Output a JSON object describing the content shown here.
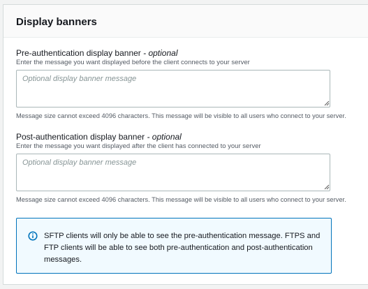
{
  "section": {
    "title": "Display banners"
  },
  "pre_auth": {
    "label": "Pre-authentication display banner",
    "optional": "- optional",
    "description": "Enter the message you want displayed before the client connects to your server",
    "placeholder": "Optional display banner message",
    "value": "",
    "hint": "Message size cannot exceed 4096 characters. This message will be visible to all users who connect to your server."
  },
  "post_auth": {
    "label": "Post-authentication display banner",
    "optional": "- optional",
    "description": "Enter the message you want displayed after the client has connected to your server",
    "placeholder": "Optional display banner message",
    "value": "",
    "hint": "Message size cannot exceed 4096 characters. This message will be visible to all users who connect to your server."
  },
  "info": {
    "icon": "info-icon",
    "text": "SFTP clients will only be able to see the pre-authentication message. FTPS and FTP clients will be able to see both pre-authentication and post-authentication messages.",
    "color": "#0073bb"
  }
}
